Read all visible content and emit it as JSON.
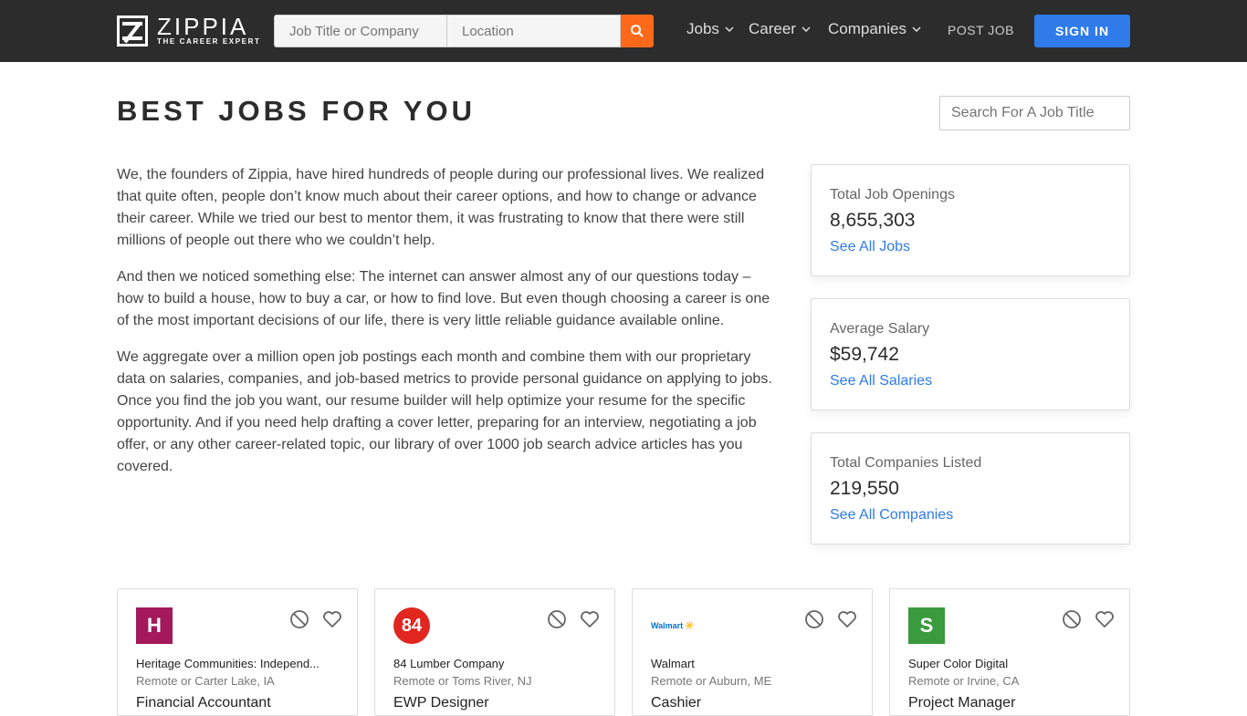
{
  "header": {
    "logo_name": "ZIPPIA",
    "logo_tagline": "THE CAREER EXPERT",
    "search_job_placeholder": "Job Title or Company",
    "search_location_placeholder": "Location",
    "nav": [
      {
        "label": "Jobs"
      },
      {
        "label": "Career"
      },
      {
        "label": "Companies"
      }
    ],
    "post_job": "POST JOB",
    "sign_in": "SIGN IN"
  },
  "main": {
    "title": "BEST JOBS FOR YOU",
    "title_search_placeholder": "Search For A Job Title",
    "paragraphs": [
      "We, the founders of Zippia, have hired hundreds of people during our professional lives. We realized that quite often, people don’t know much about their career options, and how to change or advance their career. While we tried our best to mentor them, it was frustrating to know that there were still millions of people out there who we couldn’t help.",
      "And then we noticed something else: The internet can answer almost any of our questions today – how to build a house, how to buy a car, or how to find love. But even though choosing a career is one of the most important decisions of our life, there is very little reliable guidance available online.",
      "We aggregate over a million open job postings each month and combine them with our proprietary data on salaries, companies, and job-based metrics to provide personal guidance on applying to jobs. Once you find the job you want, our resume builder will help optimize your resume for the specific opportunity. And if you need help drafting a cover letter, preparing for an interview, negotiating a job offer, or any other career-related topic, our library of over 1000 job search advice articles has you covered."
    ]
  },
  "stats": [
    {
      "label": "Total Job Openings",
      "value": "8,655,303",
      "link": "See All Jobs"
    },
    {
      "label": "Average Salary",
      "value": "$59,742",
      "link": "See All Salaries"
    },
    {
      "label": "Total Companies Listed",
      "value": "219,550",
      "link": "See All Companies"
    }
  ],
  "jobs": [
    {
      "logo_text": "H",
      "logo_color": "#a3195b",
      "company": "Heritage Communities: Independ...",
      "location": "Remote or Carter Lake, IA",
      "title": "Financial Accountant"
    },
    {
      "logo_text": "84",
      "logo_color": "#e0261f",
      "company": "84 Lumber Company",
      "location": "Remote or Toms River, NJ",
      "title": "EWP Designer"
    },
    {
      "logo_text": "Walmart",
      "logo_color": "#0071ce",
      "company": "Walmart",
      "location": "Remote or Auburn, ME",
      "title": "Cashier"
    },
    {
      "logo_text": "S",
      "logo_color": "#3a9a3e",
      "company": "Super Color Digital",
      "location": "Remote or Irvine, CA",
      "title": "Project Manager"
    }
  ],
  "colors": {
    "accent": "#2f7bea",
    "search_button": "#ff6a1a",
    "header_bg": "#2c2c2c"
  }
}
